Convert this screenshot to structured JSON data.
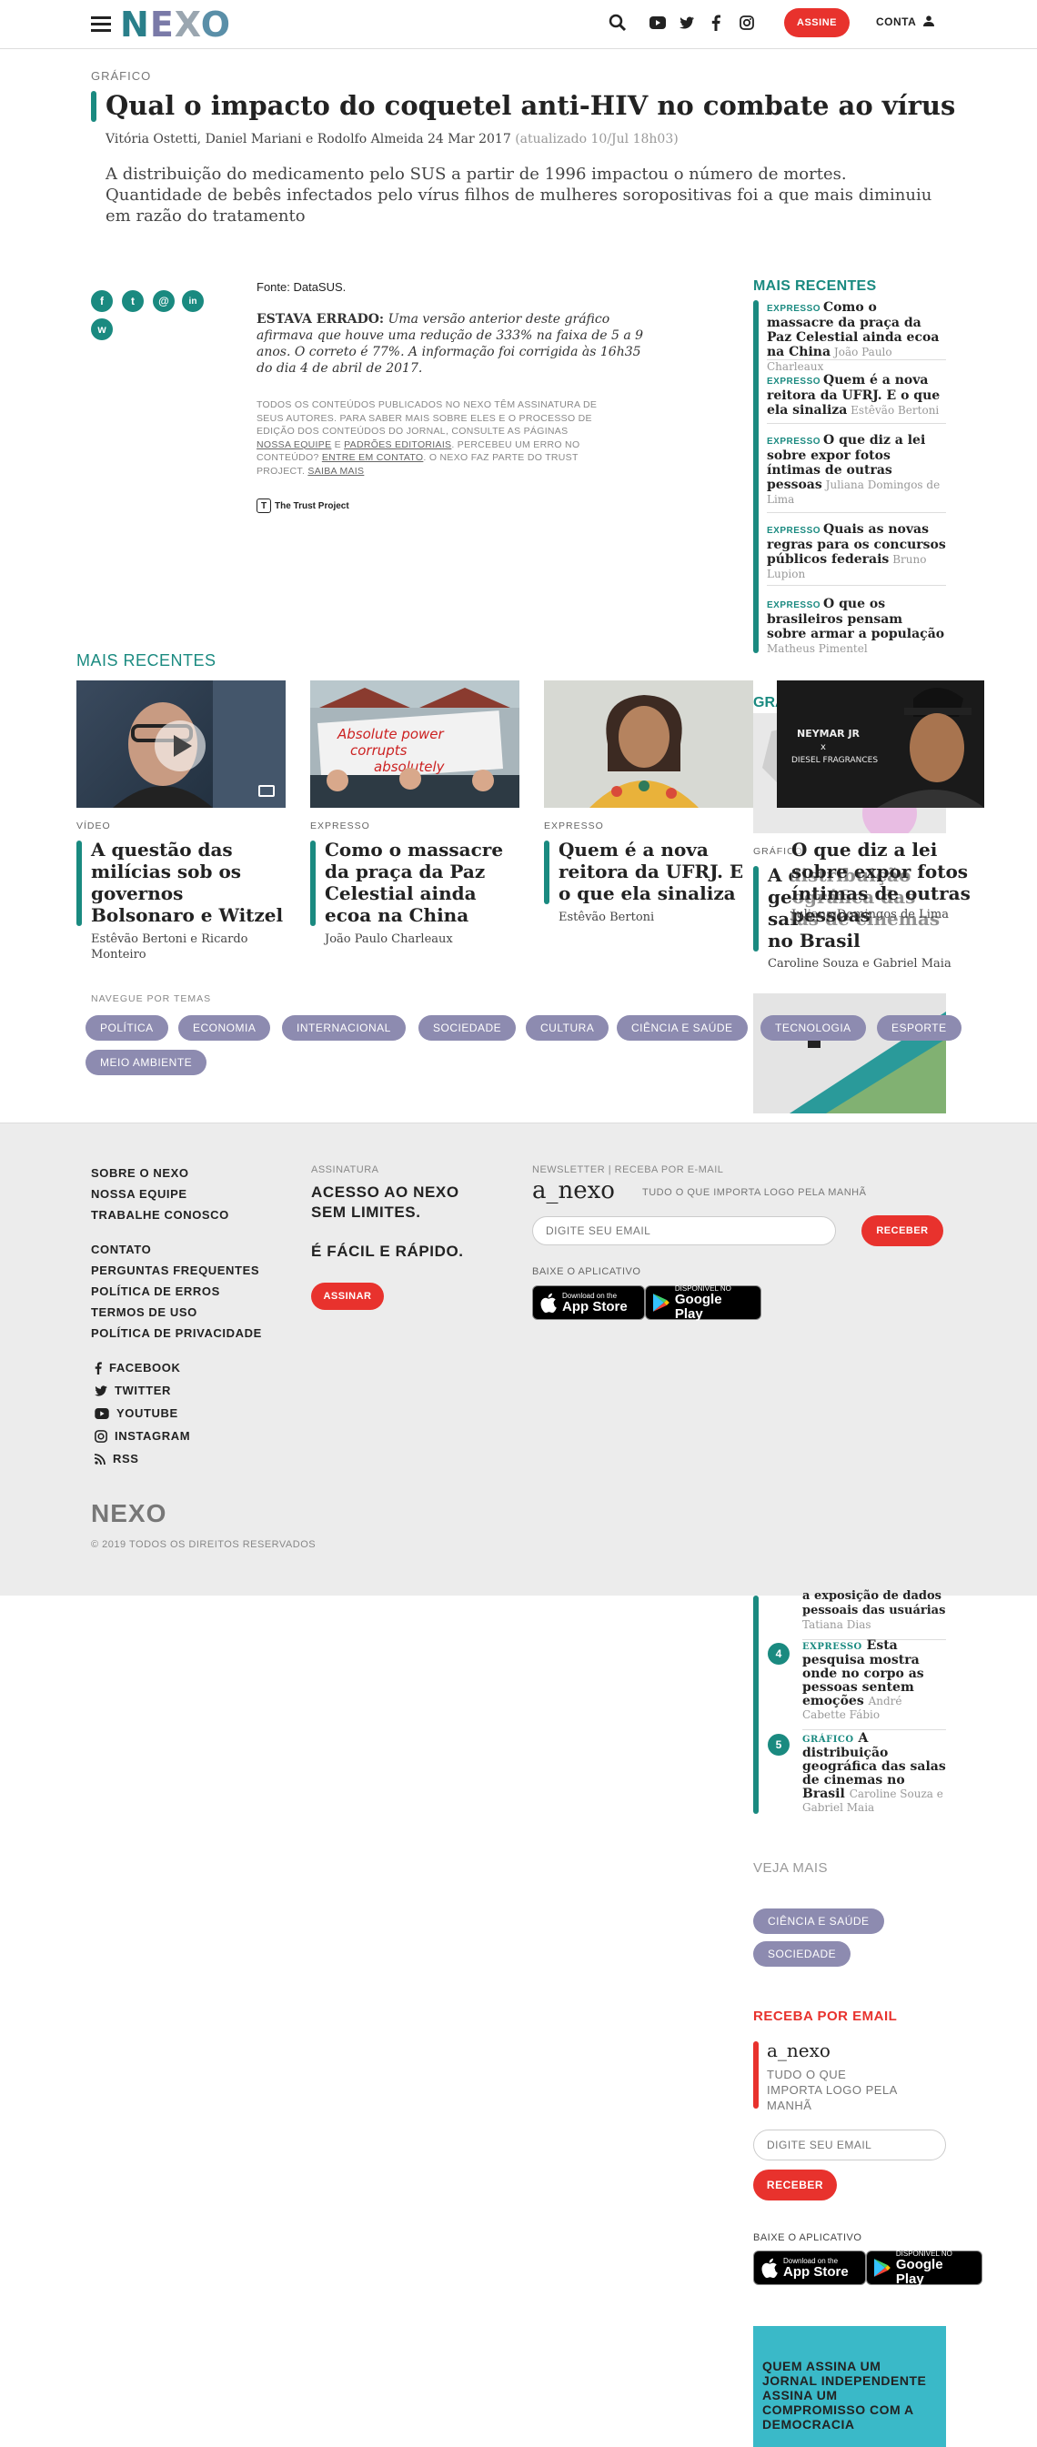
{
  "header": {
    "logo": "NEXO",
    "assine": "ASSINE",
    "conta": "CONTA"
  },
  "article": {
    "kicker": "GRÁFICO",
    "title": "Qual o impacto do coquetel anti-HIV no combate ao vírus",
    "authors": "Vitória Ostetti, Daniel Mariani e Rodolfo Almeida",
    "date": "24 Mar 2017",
    "updated": "(atualizado 10/Jul 18h03)",
    "lead": "A distribuição do medicamento pelo SUS a partir de 1996 impactou o número de mortes. Quantidade de bebês infectados pelo vírus filhos de mulheres soropositivas foi a que mais diminuiu em razão do tratamento",
    "fonte": "Fonte: DataSUS.",
    "erro_label": "ESTAVA ERRADO:",
    "erro_text": "Uma versão anterior deste gráfico afirmava que houve uma redução de 333% na faixa de 5 a 9 anos. O correto é 77%. A informação foi corrigida às 16h35 do dia 4 de abril de 2017.",
    "fineprint_1": "TODOS OS CONTEÚDOS PUBLICADOS NO NEXO TÊM ASSINATURA DE SEUS AUTORES. PARA SABER MAIS SOBRE ELES E O PROCESSO DE EDIÇÃO DOS CONTEÚDOS DO JORNAL, CONSULTE AS PÁGINAS",
    "fineprint_link1": "NOSSA EQUIPE",
    "fineprint_e": "E",
    "fineprint_link2": "PADRÕES EDITORIAIS",
    "fineprint_2": ". PERCEBEU UM ERRO NO CONTEÚDO?",
    "fineprint_link3": "ENTRE EM CONTATO",
    "fineprint_3": ". O NEXO FAZ PARTE DO TRUST PROJECT.",
    "fineprint_link4": "SAIBA MAIS",
    "trust": "The Trust Project"
  },
  "share": [
    "f",
    "t",
    "@",
    "in",
    "w"
  ],
  "sidebar": {
    "heading": "MAIS RECENTES",
    "items": [
      {
        "tag": "EXPRESSO",
        "title": "Como o massacre da praça da Paz Celestial ainda ecoa na China",
        "author": "João Paulo Charleaux"
      },
      {
        "tag": "EXPRESSO",
        "title": "Quem é a nova reitora da UFRJ. E o que ela sinaliza",
        "author": "Estêvão Bertoni"
      },
      {
        "tag": "EXPRESSO",
        "title": "O que diz a lei sobre expor fotos íntimas de outras pessoas",
        "author": "Juliana Domingos de Lima"
      },
      {
        "tag": "EXPRESSO",
        "title": "Quais as novas regras para os concursos públicos federais",
        "author": "Bruno Lupion"
      },
      {
        "tag": "EXPRESSO",
        "title": "O que os brasileiros pensam sobre armar a população",
        "author": "Matheus Pimentel"
      }
    ]
  },
  "recent": {
    "heading": "MAIS RECENTES",
    "cards": [
      {
        "tag": "VÍDEO",
        "title": "A questão das milícias sob os governos Bolsonaro e Witzel",
        "author": "Estêvão Bertoni e Ricardo Monteiro"
      },
      {
        "tag": "EXPRESSO",
        "title": "Como o massacre da praça da Paz Celestial ainda ecoa na China",
        "author": "João Paulo Charleaux"
      },
      {
        "tag": "EXPRESSO",
        "title": "Quem é a nova reitora da UFRJ. E o que ela sinaliza",
        "author": "Estêvão Bertoni"
      },
      {
        "tag": "GRÁFICO",
        "title": "A distribuição geográfica das salas de cinemas no Brasil",
        "author": "Caroline Souza e Gabriel Maia"
      }
    ],
    "overlay_title": "O que diz a lei sobre expor fotos íntimas de outras pessoas",
    "overlay_author": "Juliana Domingos de Lima",
    "overlay_heading": "GRÁ",
    "img1_text_a": "Absolute power",
    "img1_text_b": "corrupts",
    "img1_text_c": "absolutely",
    "img_shirt_a": "NEYMAR JR",
    "img_shirt_b": "x",
    "img_shirt_c": "DIESEL FRAGRANCES"
  },
  "temas": {
    "heading": "NAVEGUE POR TEMAS",
    "items": [
      "POLÍTICA",
      "ECONOMIA",
      "INTERNACIONAL",
      "SOCIEDADE",
      "CULTURA",
      "CIÊNCIA E SAÚDE",
      "TECNOLOGIA",
      "ESPORTE",
      "MEIO AMBIENTE"
    ]
  },
  "footer": {
    "links_a": [
      "SOBRE O NEXO",
      "NOSSA EQUIPE",
      "TRABALHE CONOSCO"
    ],
    "links_b": [
      "CONTATO",
      "PERGUNTAS FREQUENTES",
      "POLÍTICA DE ERROS",
      "TERMOS DE USO",
      "POLÍTICA DE PRIVACIDADE"
    ],
    "social": [
      "FACEBOOK",
      "TWITTER",
      "YOUTUBE",
      "INSTAGRAM",
      "RSS"
    ],
    "assinatura_h": "ASSINATURA",
    "acesso": "ACESSO AO NEXO SEM LIMITES.",
    "facil": "É FÁCIL E RÁPIDO.",
    "assinar": "ASSINAR",
    "newsletter_h": "NEWSLETTER | RECEBA POR E-MAIL",
    "anexo": "a_nexo",
    "anexo_sub": "TUDO O QUE IMPORTA LOGO PELA MANHÃ",
    "email_placeholder": "DIGITE SEU EMAIL",
    "receber": "RECEBER",
    "baixe": "BAIXE O APLICATIVO",
    "appstore_small": "Download on the",
    "appstore_big": "App Store",
    "gplay_small": "DISPONÍVEL NO",
    "gplay_big": "Google Play",
    "logo": "NEXO",
    "copy": "© 2019 TODOS OS DIREITOS RESERVADOS"
  },
  "lower_sidebar": {
    "partial": "a exposição de dados pessoais das usuárias",
    "partial_author": "Tatiana Dias",
    "items": [
      {
        "n": "4",
        "tag": "EXPRESSO",
        "title": "Esta pesquisa mostra onde no corpo as pessoas sentem emoções",
        "author": "André Cabette Fábio"
      },
      {
        "n": "5",
        "tag": "GRÁFICO",
        "title": "A distribuição geográfica das salas de cinemas no Brasil",
        "author": "Caroline Souza e Gabriel Maia"
      }
    ],
    "veja": "VEJA MAIS",
    "veja_tags": [
      "CIÊNCIA E SAÚDE",
      "SOCIEDADE"
    ],
    "receba": "RECEBA POR EMAIL",
    "anexo": "a_nexo",
    "anexo_sub": "TUDO O QUE IMPORTA LOGO PELA MANHÃ",
    "email_placeholder": "DIGITE SEU EMAIL",
    "receber": "RECEBER",
    "baixe": "BAIXE O APLICATIVO",
    "promo": "QUEM ASSINA UM JORNAL INDEPENDENTE ASSINA UM COMPROMISSO COM A DEMOCRACIA"
  },
  "colors": {
    "accent": "#1a8a80",
    "red": "#e8322d",
    "pill": "#8d8bb0",
    "footer_bg": "#ececec",
    "promo": "#3ab9c8"
  }
}
